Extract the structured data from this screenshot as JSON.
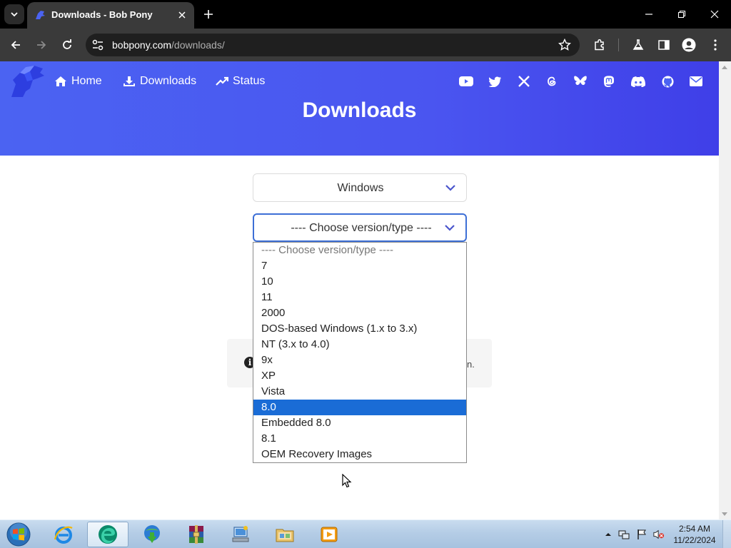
{
  "browser": {
    "tab_title": "Downloads - Bob Pony",
    "url_domain": "bobpony.com",
    "url_path": "/downloads/"
  },
  "site": {
    "nav": [
      {
        "label": "Home",
        "icon": "home-icon"
      },
      {
        "label": "Downloads",
        "icon": "download-icon"
      },
      {
        "label": "Status",
        "icon": "trend-icon"
      }
    ],
    "social_icons": [
      "youtube-icon",
      "twitter-icon",
      "x-icon",
      "threads-icon",
      "bluesky-icon",
      "mastodon-icon",
      "discord-icon",
      "github-icon",
      "email-icon"
    ],
    "hero_title": "Downloads",
    "accent_color": "#4b63f2"
  },
  "os_select": {
    "value": "Windows"
  },
  "version_select": {
    "value": "---- Choose version/type ----",
    "options": [
      "---- Choose version/type ----",
      "7",
      "10",
      "11",
      "2000",
      "DOS-based Windows (1.x to 3.x)",
      "NT (3.x to 4.0)",
      "9x",
      "XP",
      "Vista",
      "8.0",
      "Embedded 8.0",
      "8.1",
      "OEM Recovery Images"
    ],
    "highlighted": "8.0"
  },
  "info": {
    "icon_glyph": "i",
    "tail_text": "n."
  },
  "taskbar": {
    "apps": [
      "internet-explorer-icon",
      "edge-browser-icon",
      "idm-icon",
      "winrar-icon",
      "network-app-icon",
      "file-explorer-icon",
      "media-player-icon"
    ],
    "time": "2:54 AM",
    "date": "11/22/2024"
  }
}
